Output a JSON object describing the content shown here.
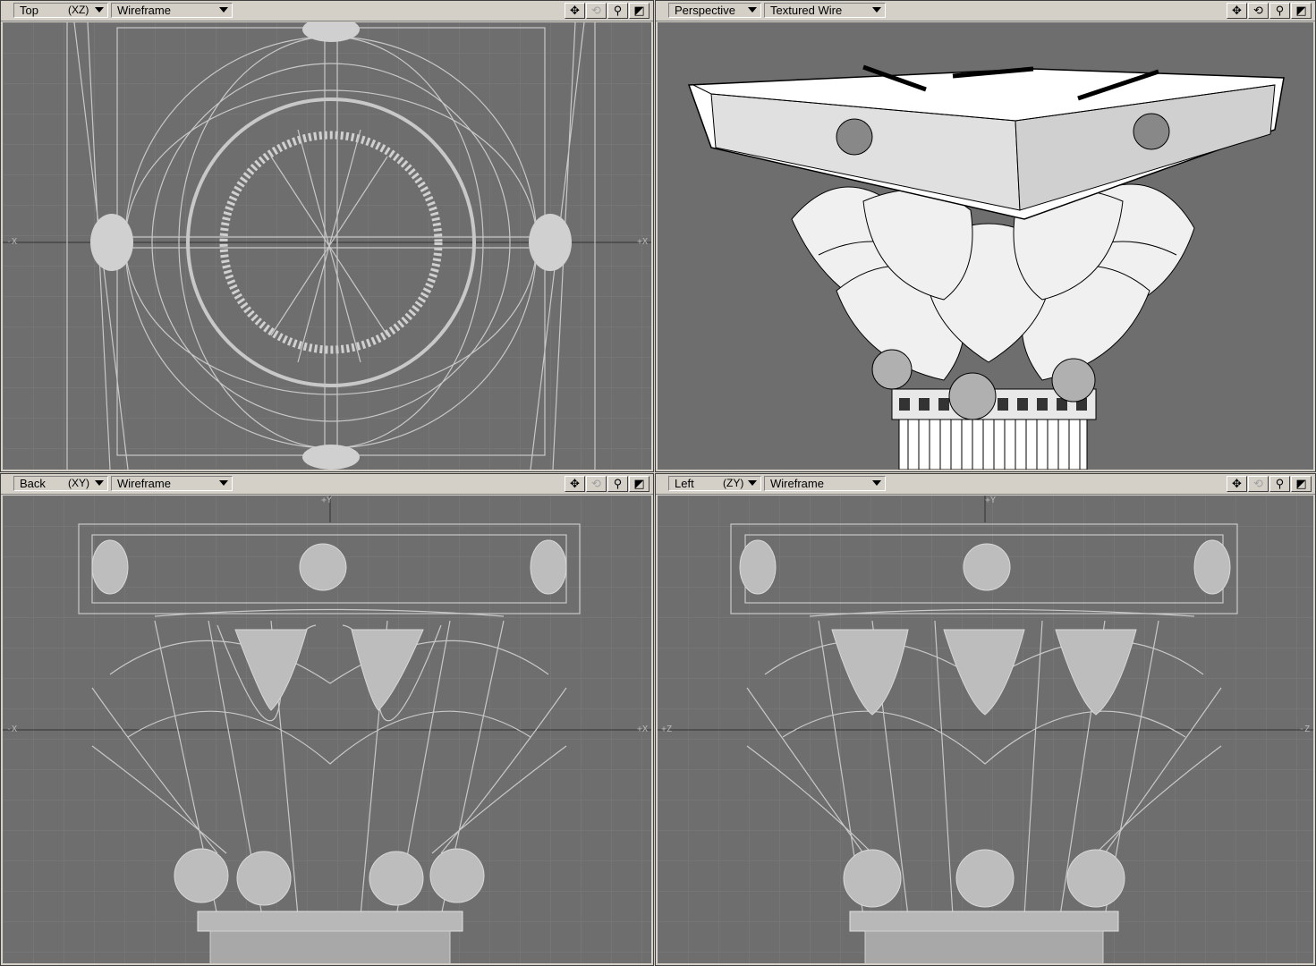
{
  "viewports": [
    {
      "view": "Top",
      "axes": "(XZ)",
      "mode": "Wireframe",
      "axis_left": "-X",
      "axis_right": "+X"
    },
    {
      "view": "Perspective",
      "axes": "",
      "mode": "Textured Wire"
    },
    {
      "view": "Back",
      "axes": "(XY)",
      "mode": "Wireframe",
      "axis_top": "+Y",
      "axis_left": "-X",
      "axis_right": "+X"
    },
    {
      "view": "Left",
      "axes": "(ZY)",
      "mode": "Wireframe",
      "axis_top": "+Y",
      "axis_left": "+Z",
      "axis_right": "-Z"
    }
  ],
  "toolbar_icons": [
    "move-view-icon",
    "rotate-view-icon",
    "zoom-view-icon",
    "maximize-view-icon"
  ],
  "colors": {
    "viewport_bg": "#6e6e6e",
    "grid": "#7a7a7a",
    "wire": "#c8c8c8",
    "panel": "#d4d0c8"
  }
}
